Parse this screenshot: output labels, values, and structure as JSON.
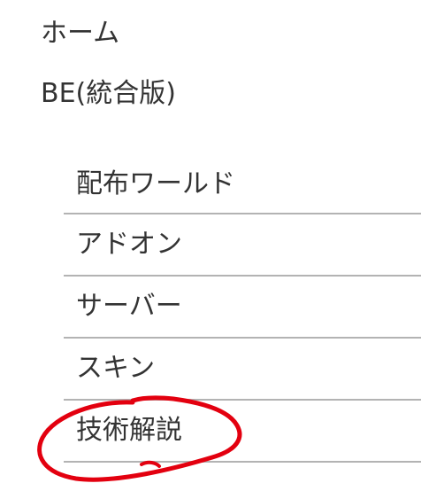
{
  "nav": {
    "home_label": "ホーム",
    "be_label": "BE(統合版)",
    "submenu": [
      {
        "label": "配布ワールド"
      },
      {
        "label": "アドオン"
      },
      {
        "label": "サーバー"
      },
      {
        "label": "スキン"
      },
      {
        "label": "技術解説"
      }
    ]
  },
  "annotation": {
    "circled_item": "技術解説",
    "color": "#e3000f"
  },
  "colors": {
    "text": "#333333",
    "divider": "#b3b3b3",
    "background": "#ffffff"
  }
}
